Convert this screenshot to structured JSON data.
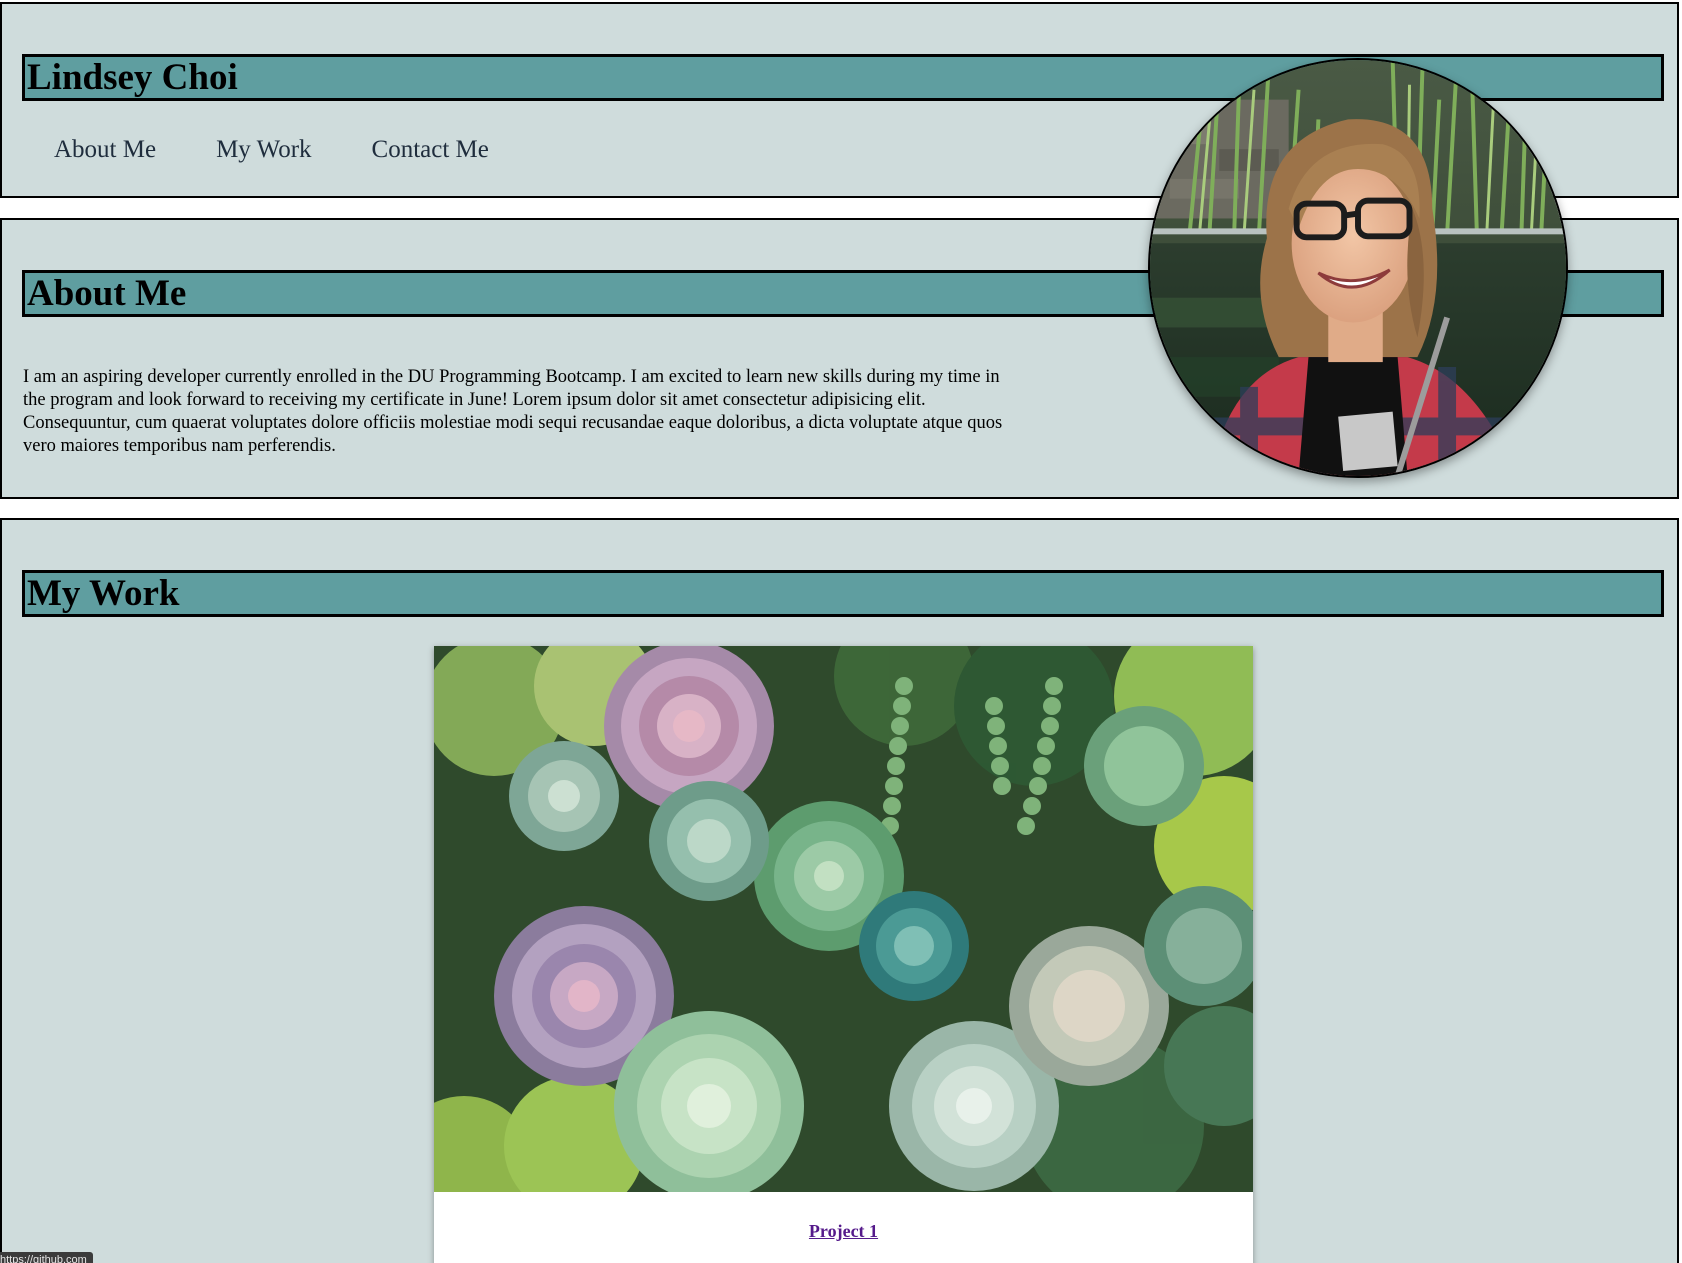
{
  "header": {
    "site_title": "Lindsey Choi",
    "nav": [
      {
        "label": "About Me"
      },
      {
        "label": "My Work"
      },
      {
        "label": "Contact Me"
      }
    ]
  },
  "about": {
    "heading": "About Me",
    "text": "I am an aspiring developer currently enrolled in the DU Programming Bootcamp. I am excited to learn new skills during my time in the program and look forward to receiving my certificate in June! Lorem ipsum dolor sit amet consectetur adipisicing elit. Consequuntur, cum quaerat voluptates dolore officiis molestiae modi sequi recusandae eaque doloribus, a dicta voluptate atque quos vero maiores temporibus nam perferendis."
  },
  "work": {
    "heading": "My Work",
    "projects": [
      {
        "label": "Project 1"
      }
    ]
  },
  "status_bar": {
    "text": "https://github.com"
  },
  "colors": {
    "panel_background": "#cfdcdc",
    "title_bar": "#5f9ea0",
    "link_visited": "#551a8b"
  }
}
